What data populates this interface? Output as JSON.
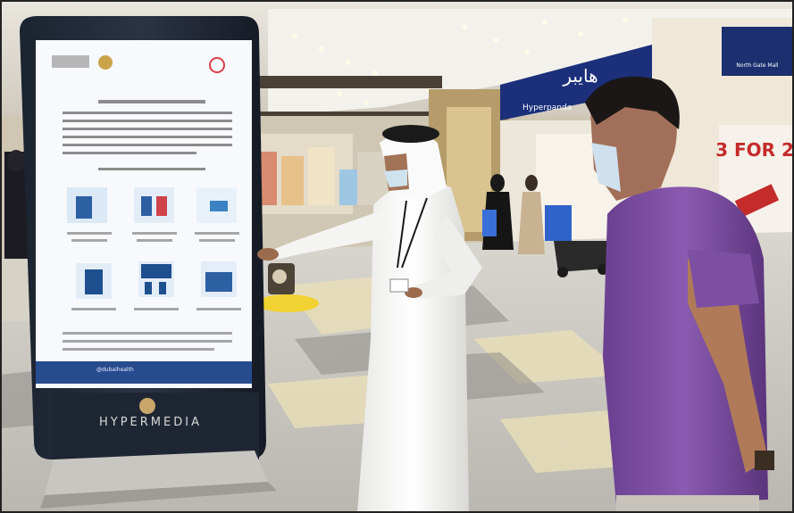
{
  "signage": {
    "brand": "HYPERMEDIA",
    "footer_line": "@dubaihealth"
  },
  "storefronts": {
    "main_sign": "هايبر",
    "left_sign": "Hyperpanda",
    "right_sign": "North Gate Mall"
  },
  "promo": {
    "text": "3 FOR 2"
  }
}
